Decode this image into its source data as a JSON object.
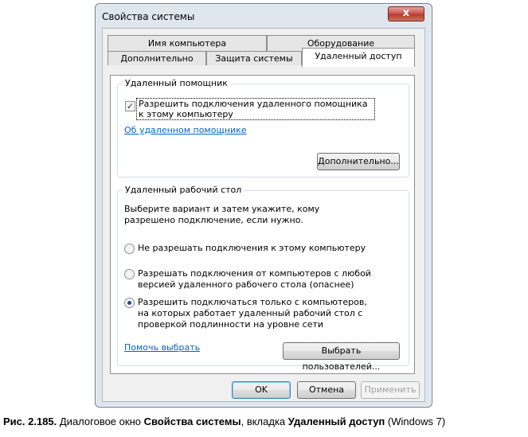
{
  "window": {
    "title": "Свойства системы",
    "close_glyph": "x"
  },
  "tabs": {
    "row1": [
      "Имя компьютера",
      "Оборудование"
    ],
    "row2": [
      "Дополнительно",
      "Защита системы",
      "Удаленный доступ"
    ]
  },
  "remote_assistance": {
    "group_label": "Удаленный помощник",
    "checkbox_label": "Разрешить подключения удаленного помощника к этому компьютеру",
    "checkbox_checked": true,
    "link": "Об удаленном помощнике",
    "advanced_button": "Дополнительно..."
  },
  "remote_desktop": {
    "group_label": "Удаленный рабочий стол",
    "description": "Выберите вариант и затем укажите, кому разрешено подключение, если нужно.",
    "options": [
      "Не разрешать подключения к этому компьютеру",
      "Разрешать подключения от компьютеров с любой версией удаленного рабочего стола (опаснее)",
      "Разрешить подключаться только с компьютеров, на которых работает удаленный рабочий стол с проверкой подлинности на уровне сети"
    ],
    "selected_option": 2,
    "help_link": "Помочь выбрать",
    "select_users_button": "Выбрать пользователей..."
  },
  "buttons": {
    "ok": "OK",
    "cancel": "Отмена",
    "apply": "Применить"
  },
  "caption": {
    "prefix": "Рис. 2.185.",
    "text1": " Диалоговое окно ",
    "bold1": "Свойства системы",
    "text2": ", вкладка ",
    "bold2": "Удаленный доступ",
    "text3": " (Windows 7)"
  }
}
